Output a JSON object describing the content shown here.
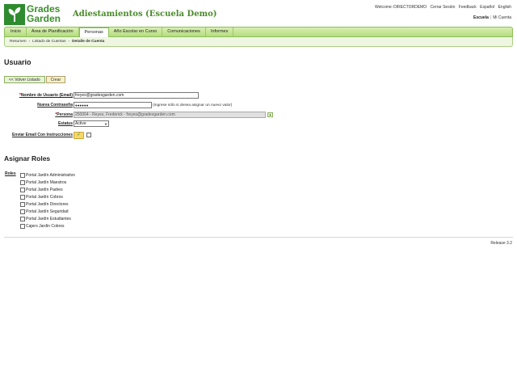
{
  "header": {
    "logo_text_1": "Grades",
    "logo_text_2": "Garden",
    "app_title": "Adiestamientos (Escuela Demo)",
    "welcome_label": "Welcome:",
    "username": "DIRECTORDEMO",
    "links": [
      "Cerrar Sesión",
      "Feedback",
      "Español",
      "English"
    ],
    "school_label": "Escuela",
    "my_account": "Mi Cuenta"
  },
  "nav": {
    "tabs": [
      "Inicio",
      "Área de Planificación",
      "Personas",
      "Año Escolar en Curso",
      "Comunicaciones",
      "Informes"
    ],
    "active": "Personas"
  },
  "breadcrumb": [
    "Resumen",
    "Listado de Cuentas",
    "Detalle de Cuenta"
  ],
  "page": {
    "title": "Usuario",
    "back_button": "<< Volver Listado",
    "create_button": "Crear"
  },
  "form": {
    "username_label": "Nombre de Usuario (Email)",
    "username_value": "freyes@gradesgarden.com",
    "password_label": "Nueva Contraseña",
    "password_value": "●●●●●●",
    "password_hint": "(Ingrese sólo si desea asignar un nuevo valor)",
    "person_label": "Persona",
    "person_value": "250064 - Reyes, Frederick - freyes@gradesgarden.com",
    "status_label": "Estatus",
    "status_value": "Active",
    "send_email_label": "Enviar Email Con Instrucciones"
  },
  "roles": {
    "title": "Asignar Roles",
    "label": "Roles",
    "items": [
      "Portal Jardín Administrativo",
      "Portal Jardín Maestros",
      "Portal Jardín Padres",
      "Portal Jardín Cobros",
      "Portal Jardín Directores",
      "Portal Jardín Seguridad",
      "Portal Jardín Estudiantes",
      "Cajero Jardín Cobros"
    ]
  },
  "footer": {
    "release": "Release 3.2"
  }
}
